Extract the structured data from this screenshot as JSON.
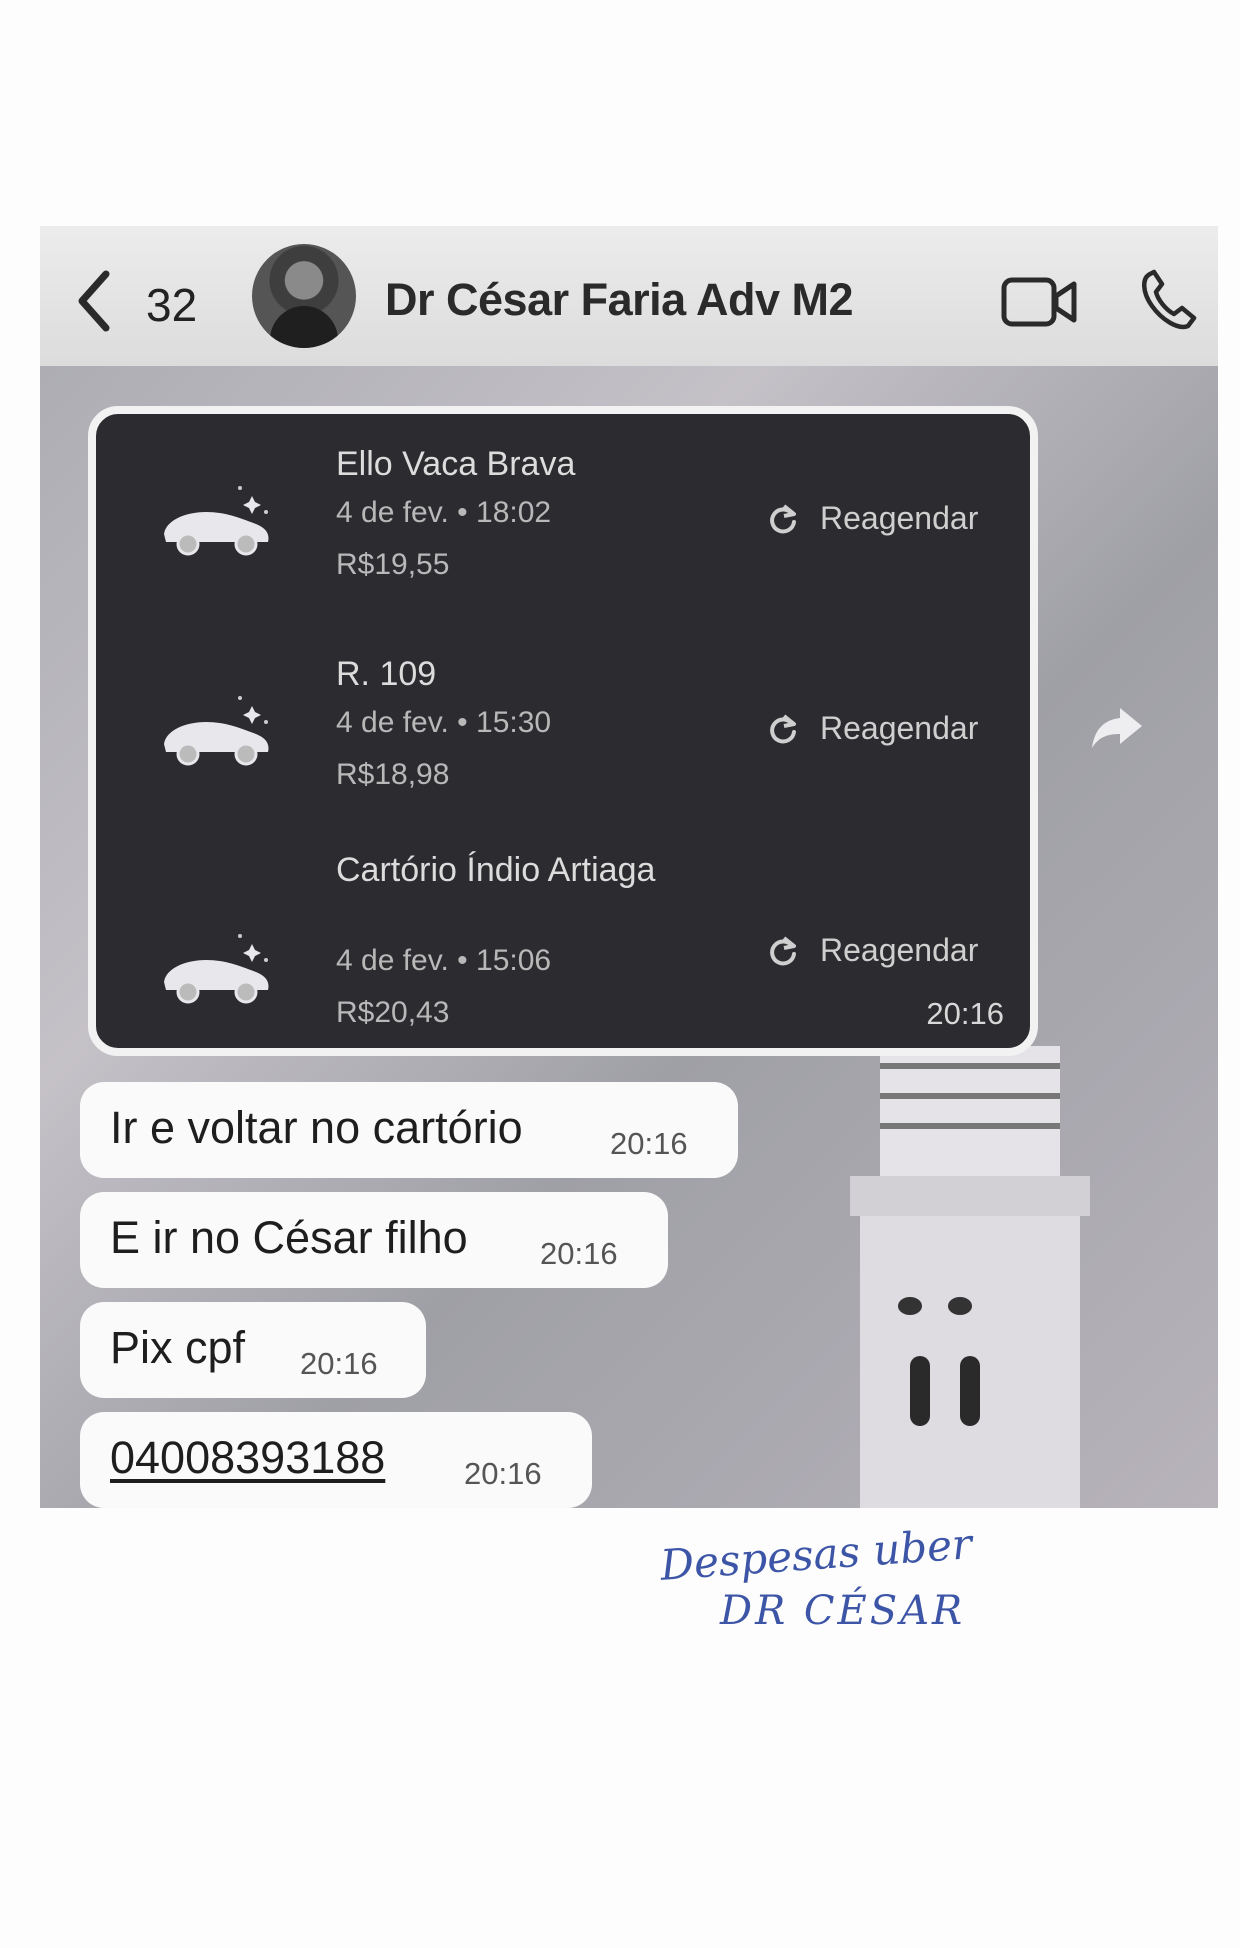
{
  "header": {
    "back_count": "32",
    "contact_name": "Dr César Faria Adv M2"
  },
  "trips": [
    {
      "title": "Ello Vaca Brava",
      "date": "4 de fev. • 18:02",
      "price": "R$19,55",
      "action": "Reagendar"
    },
    {
      "title": "R. 109",
      "date": "4 de fev. • 15:30",
      "price": "R$18,98",
      "action": "Reagendar"
    },
    {
      "title": "Cartório Índio Artiaga",
      "date": "4 de fev. • 15:06",
      "price": "R$20,43",
      "action": "Reagendar"
    }
  ],
  "trip_card_time": "20:16",
  "messages": [
    {
      "text": "Ir e voltar no cartório",
      "time": "20:16"
    },
    {
      "text": "E ir no César filho",
      "time": "20:16"
    },
    {
      "text": "Pix cpf",
      "time": "20:16"
    },
    {
      "text": "04008393188",
      "time": "20:16"
    }
  ],
  "annotation": {
    "line1": "Despesas uber",
    "line2": "DR CÉSAR"
  },
  "colors": {
    "card_bg": "#2c2c30",
    "bubble_bg": "#fafafa",
    "ink_blue": "#3d55a6"
  },
  "icons": [
    "chevron-left-icon",
    "avatar",
    "video-camera-icon",
    "phone-icon",
    "car-icon",
    "refresh-icon",
    "forward-icon"
  ]
}
